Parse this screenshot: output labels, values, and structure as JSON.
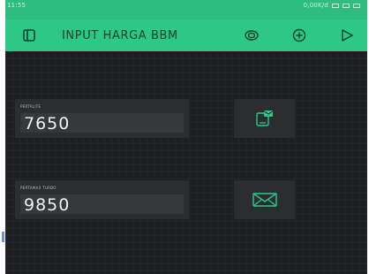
{
  "statusbar": {
    "time": "11:55",
    "right_text": "0,00K/d"
  },
  "toolbar": {
    "title": "INPUT HARGA BBM",
    "left_icon": "project-switch-icon",
    "icons": [
      "settings-icon",
      "add-widget-icon",
      "play-icon"
    ]
  },
  "widgets": [
    {
      "label": "PERTALITE",
      "value": "7650",
      "action_icon": "email-app-icon"
    },
    {
      "label": "PERTAMAX TURBO",
      "value": "9850",
      "action_icon": "mail-icon"
    }
  ],
  "colors": {
    "accent": "#2ec886",
    "background": "#1c1e1f",
    "widget": "#2b2e30",
    "icon": "#2ec886"
  }
}
